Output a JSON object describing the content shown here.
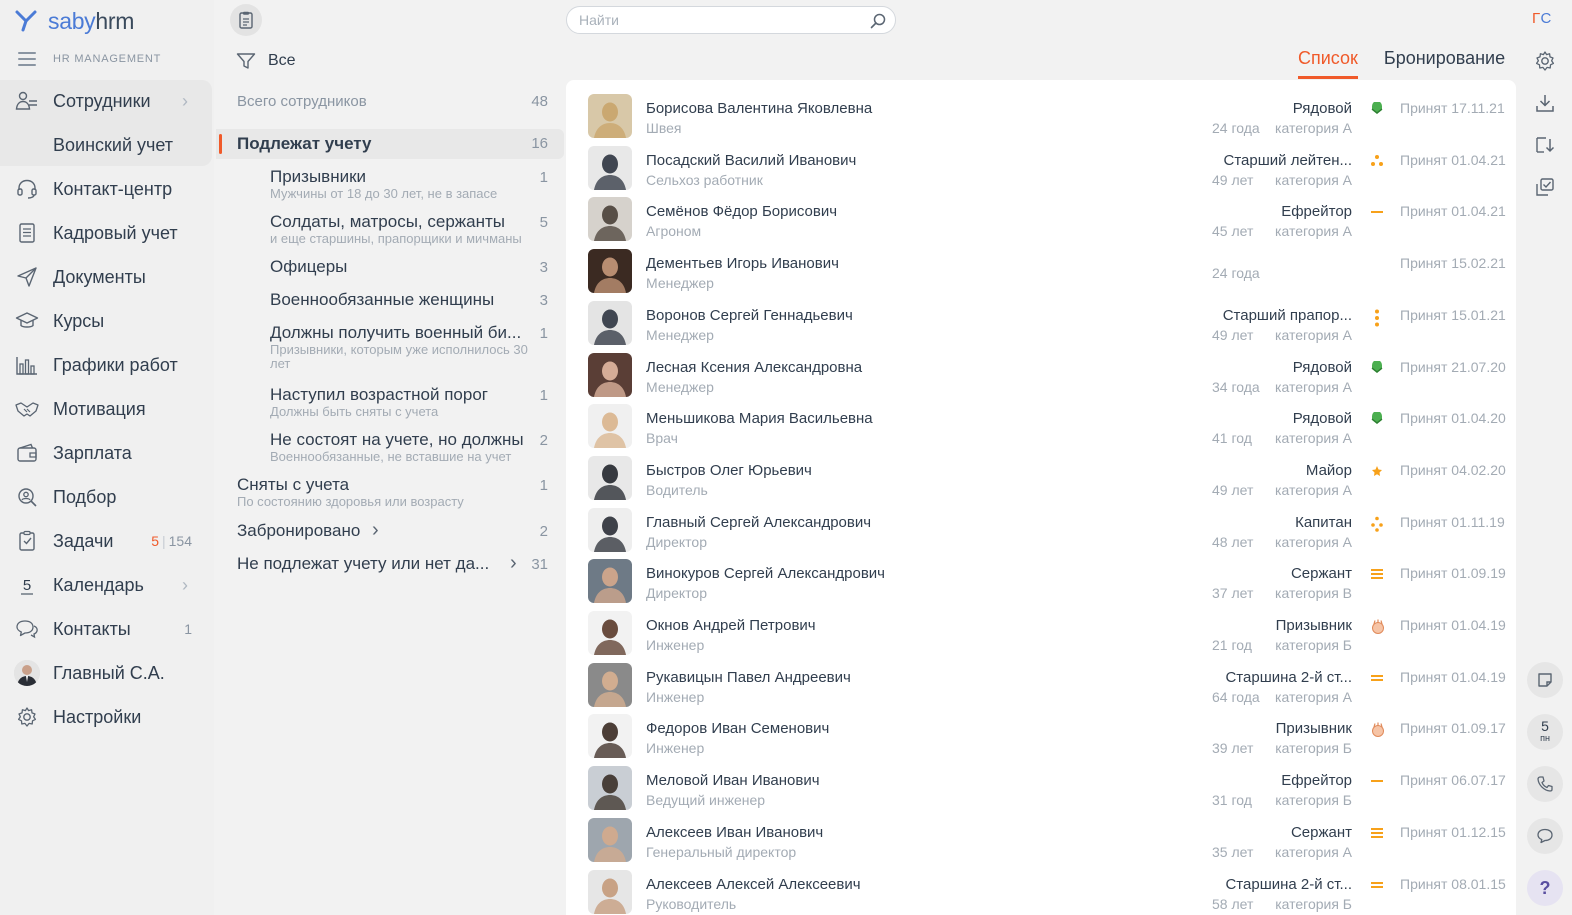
{
  "app": {
    "brand_a": "saby",
    "brand_b": "hrm",
    "subtitle": "HR MANAGEMENT"
  },
  "nav": {
    "items": [
      {
        "label": "Сотрудники",
        "icon": "users-icon",
        "chevron": true
      },
      {
        "label": "Воинский учет",
        "icon": "",
        "sub": true
      },
      {
        "label": "Контакт-центр",
        "icon": "headset-icon"
      },
      {
        "label": "Кадровый учет",
        "icon": "document-list-icon"
      },
      {
        "label": "Документы",
        "icon": "paper-plane-icon"
      },
      {
        "label": "Курсы",
        "icon": "graduation-cap-icon"
      },
      {
        "label": "Графики работ",
        "icon": "bar-chart-icon"
      },
      {
        "label": "Мотивация",
        "icon": "handshake-icon"
      },
      {
        "label": "Зарплата",
        "icon": "wallet-icon"
      },
      {
        "label": "Подбор",
        "icon": "search-person-icon"
      },
      {
        "label": "Задачи",
        "icon": "tasks-icon",
        "count_a": "5",
        "count_b": "154"
      },
      {
        "label": "Календарь",
        "icon": "calendar-icon",
        "chevron": true,
        "day": "5"
      },
      {
        "label": "Контакты",
        "icon": "chat-icon",
        "count": "1"
      },
      {
        "label": "Главный С.А.",
        "icon": "avatar"
      },
      {
        "label": "Настройки",
        "icon": "gear-icon"
      }
    ]
  },
  "search": {
    "placeholder": "Найти"
  },
  "filter": {
    "label": "Все"
  },
  "tabs": [
    {
      "label": "Список",
      "active": true
    },
    {
      "label": "Бронирование"
    }
  ],
  "groups": [
    {
      "title": "Всего сотрудников",
      "count": "48",
      "kind": "header"
    },
    {
      "title": "Подлежат учету",
      "count": "16",
      "kind": "active"
    },
    {
      "title": "Призывники",
      "sub": "Мужчины от 18 до 30 лет, не в запасе",
      "count": "1",
      "kind": "child"
    },
    {
      "title": "Солдаты, матросы, сержанты",
      "sub": "и еще старшины, прапорщики и мичманы",
      "count": "5",
      "kind": "child"
    },
    {
      "title": "Офицеры",
      "count": "3",
      "kind": "child"
    },
    {
      "title": "Военнообязанные женщины",
      "count": "3",
      "kind": "child"
    },
    {
      "title": "Должны получить военный би...",
      "sub": "Призывники, которым уже исполнилось 30 лет",
      "count": "1",
      "kind": "child"
    },
    {
      "title": "Наступил возрастной порог",
      "sub": "Должны быть сняты с учета",
      "count": "1",
      "kind": "child"
    },
    {
      "title": "Не состоят на учете, но должны",
      "sub": "Военнообязанные, не вставшие на учет",
      "count": "2",
      "kind": "child"
    },
    {
      "title": "Сняты с учета",
      "sub": "По состоянию здоровья или возрасту",
      "count": "1",
      "kind": "top"
    },
    {
      "title": "Забронировано",
      "count": "2",
      "kind": "top",
      "chevron": true
    },
    {
      "title": "Не подлежат учету или нет да...",
      "count": "31",
      "kind": "top",
      "chevron": true
    }
  ],
  "employees": [
    {
      "name": "Борисова Валентина Яковлевна",
      "position": "Швея",
      "rank": "Рядовой",
      "age": "24 года",
      "category": "категория А",
      "insignia": "rank-private-icon",
      "hired": "Принят 17.11.21",
      "photo_bg": "#d8c8a8",
      "photo_fg": "#c9a46a"
    },
    {
      "name": "Посадский Василий Иванович",
      "position": "Сельхоз работник",
      "rank": "Старший лейтен...",
      "age": "49 лет",
      "category": "категория А",
      "insignia": "rank-three-stars-icon",
      "hired": "Принят 01.04.21",
      "photo_bg": "#e8e8e8",
      "photo_fg": "#2d3440"
    },
    {
      "name": "Семёнов Фёдор Борисович",
      "position": "Агроном",
      "rank": "Ефрейтор",
      "age": "45 лет",
      "category": "категория А",
      "insignia": "rank-one-bar-icon",
      "hired": "Принят 01.04.21",
      "photo_bg": "#d6d2cc",
      "photo_fg": "#4a4038"
    },
    {
      "name": "Дементьев Игорь Иванович",
      "position": "Менеджер",
      "rank": "",
      "age": "24 года",
      "category": "",
      "insignia": "",
      "hired": "Принят 15.02.21",
      "photo_bg": "#3b2a22",
      "photo_fg": "#c7987a"
    },
    {
      "name": "Воронов Сергей Геннадьевич",
      "position": "Менеджер",
      "rank": "Старший прапор...",
      "age": "49 лет",
      "category": "категория А",
      "insignia": "rank-vertical-stars-icon",
      "hired": "Принят 15.01.21",
      "photo_bg": "#e4e4e4",
      "photo_fg": "#2d3440"
    },
    {
      "name": "Лесная Ксения Александровна",
      "position": "Менеджер",
      "rank": "Рядовой",
      "age": "34 года",
      "category": "категория А",
      "insignia": "rank-private-icon",
      "hired": "Принят 21.07.20",
      "photo_bg": "#5a3e36",
      "photo_fg": "#e2b8a2"
    },
    {
      "name": "Меньшикова Мария Васильевна",
      "position": "Врач",
      "rank": "Рядовой",
      "age": "41 год",
      "category": "категория А",
      "insignia": "rank-private-icon",
      "hired": "Принят 01.04.20",
      "photo_bg": "#f0f0f0",
      "photo_fg": "#d9b48c"
    },
    {
      "name": "Быстров Олег Юрьевич",
      "position": "Водитель",
      "rank": "Майор",
      "age": "49 лет",
      "category": "категория А",
      "insignia": "rank-one-star-icon",
      "hired": "Принят 04.02.20",
      "photo_bg": "#e8e8e8",
      "photo_fg": "#22262c"
    },
    {
      "name": "Главный Сергей Александрович",
      "position": "Директор",
      "rank": "Капитан",
      "age": "48 лет",
      "category": "категория А",
      "insignia": "rank-four-stars-icon",
      "hired": "Принят 01.11.19",
      "photo_bg": "#eeeeee",
      "photo_fg": "#2a2e36"
    },
    {
      "name": "Винокуров Сергей Александрович",
      "position": "Директор",
      "rank": "Сержант",
      "age": "37 лет",
      "category": "категория В",
      "insignia": "rank-three-bars-icon",
      "hired": "Принят 01.09.19",
      "photo_bg": "#6e7a86",
      "photo_fg": "#d5a98c"
    },
    {
      "name": "Окнов Андрей Петрович",
      "position": "Инженер",
      "rank": "Призывник",
      "age": "21 год",
      "category": "категория Б",
      "insignia": "rank-conscript-icon",
      "hired": "Принят 01.04.19",
      "photo_bg": "#f2f2f2",
      "photo_fg": "#5a3a2a"
    },
    {
      "name": "Рукавицын Павел Андреевич",
      "position": "Инженер",
      "rank": "Старшина 2-й ст...",
      "age": "64 года",
      "category": "категория А",
      "insignia": "rank-two-bars-icon",
      "hired": "Принят 01.04.19",
      "photo_bg": "#8a8a8a",
      "photo_fg": "#d8b090"
    },
    {
      "name": "Федоров Иван Семенович",
      "position": "Инженер",
      "rank": "Призывник",
      "age": "39 лет",
      "category": "категория Б",
      "insignia": "rank-conscript-icon",
      "hired": "Принят 01.09.17",
      "photo_bg": "#f2f2f2",
      "photo_fg": "#3a2a22"
    },
    {
      "name": "Меловой Иван Иванович",
      "position": "Ведущий инженер",
      "rank": "Ефрейтор",
      "age": "31 год",
      "category": "категория Б",
      "insignia": "rank-one-bar-icon",
      "hired": "Принят 06.07.17",
      "photo_bg": "#c9ced4",
      "photo_fg": "#3a3028"
    },
    {
      "name": "Алексеев Иван Иванович",
      "position": "Генеральный директор",
      "rank": "Сержант",
      "age": "35 лет",
      "category": "категория А",
      "insignia": "rank-three-bars-icon",
      "hired": "Принят 01.12.15",
      "photo_bg": "#9ea6ae",
      "photo_fg": "#d4ab8c"
    },
    {
      "name": "Алексеев Алексей Алексеевич",
      "position": "Руководитель",
      "rank": "Старшина 2-й ст...",
      "age": "58 лет",
      "category": "категория Б",
      "insignia": "rank-two-bars-icon",
      "hired": "Принят 08.01.15",
      "photo_bg": "#e6e6e6",
      "photo_fg": "#c49a7a"
    }
  ],
  "right_bar": {
    "initials_a": "Г",
    "initials_b": "С",
    "calendar_day": "5",
    "calendar_weekday": "пн",
    "help": "?"
  },
  "colors": {
    "accent": "#f05a2a",
    "brand": "#4b7bd6",
    "insignia_orange": "#f7a11a",
    "insignia_green": "#4caf50"
  }
}
